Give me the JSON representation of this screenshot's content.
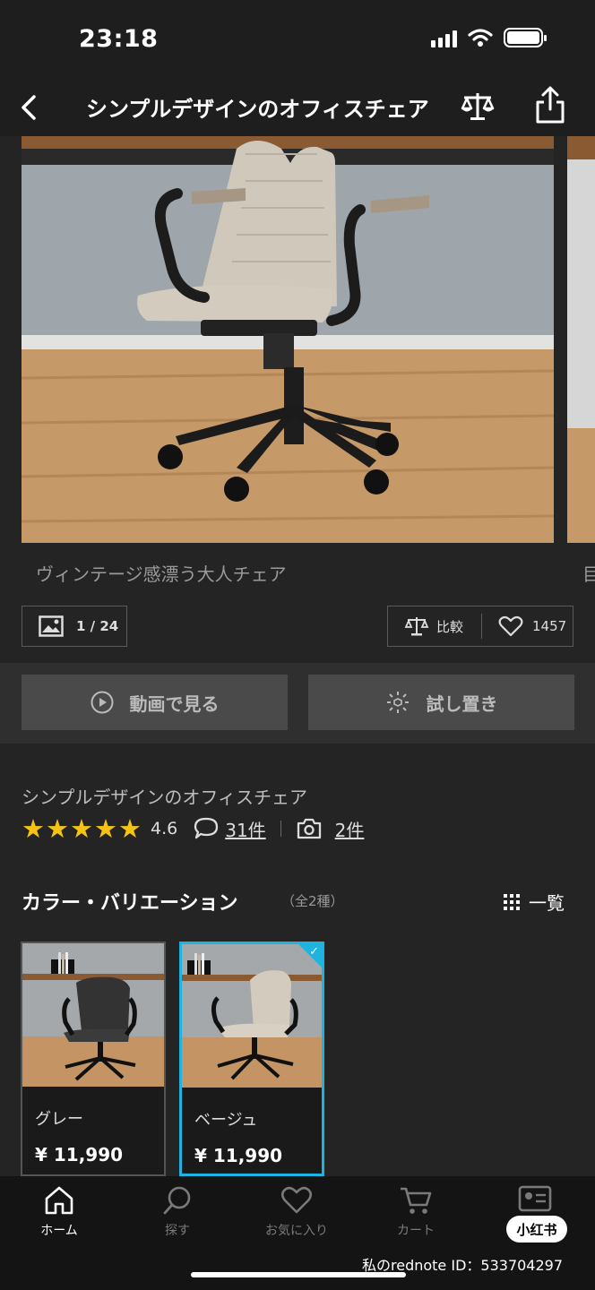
{
  "status_bar": {
    "time": "23:18"
  },
  "nav": {
    "title": "シンプルデザインのオフィスチェア"
  },
  "gallery": {
    "caption": "ヴィンテージ感漂う大人チェア",
    "caption_next": "目",
    "image_counter": "1 / 24",
    "compare_label": "比較",
    "favorite_count": "1457"
  },
  "media_buttons": {
    "video_label": "動画で見る",
    "tryon_label": "試し置き"
  },
  "product": {
    "name": "シンプルデザインのオフィスチェア",
    "rating": "4.6",
    "review_count": "31件",
    "photo_review_count": "2件"
  },
  "color_variations": {
    "title": "カラー・バリエーション",
    "count": "（全2種）",
    "list_label": "一覧",
    "items": [
      {
        "name": "グレー",
        "price": "¥ 11,990"
      },
      {
        "name": "ベージュ",
        "price": "¥ 11,990",
        "selected": true
      }
    ]
  },
  "tab_bar": {
    "items": [
      {
        "label": "ホーム",
        "active": true
      },
      {
        "label": "探す"
      },
      {
        "label": "お気に入り"
      },
      {
        "label": "カート"
      }
    ]
  },
  "overlay": {
    "badge": "小红书",
    "watermark": "私のrednote ID：533704297"
  },
  "colors": {
    "accent": "#1fb4e0",
    "star": "#f4c315",
    "background": "#242424"
  }
}
